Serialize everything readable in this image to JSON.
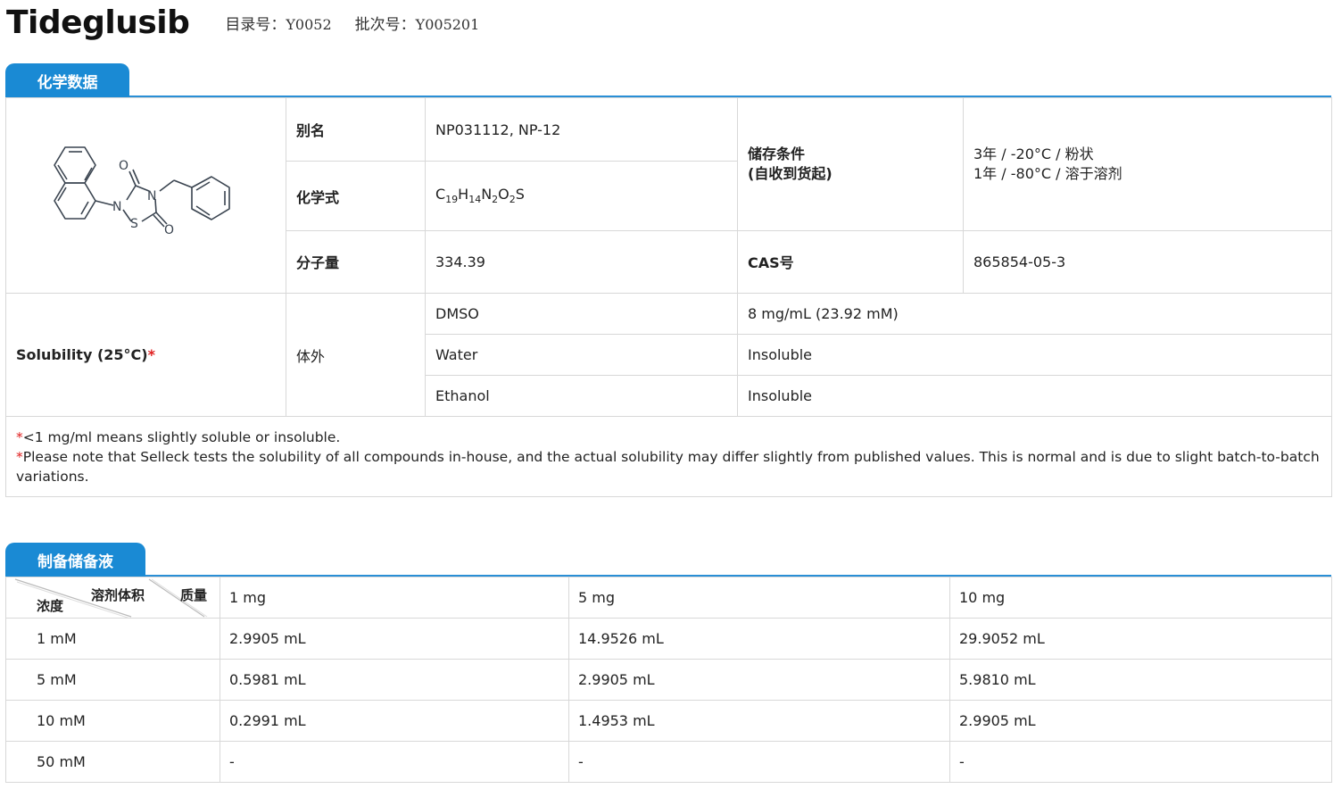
{
  "header": {
    "product_name": "Tideglusib",
    "catalog_label": "目录号：",
    "catalog_value": "Y0052",
    "batch_label": "批次号：",
    "batch_value": "Y005201"
  },
  "chemical_section": {
    "tab_label": "化学数据",
    "structure": {
      "atom_labels": [
        "O",
        "N",
        "N",
        "S",
        "O"
      ]
    },
    "alias_label": "别名",
    "alias_value": "NP031112, NP-12",
    "formula_label": "化学式",
    "formula_parts": [
      "C",
      "19",
      "H",
      "14",
      "N",
      "2",
      "O",
      "2",
      "S"
    ],
    "mw_label": "分子量",
    "mw_value": "334.39",
    "storage_label_line1": "储存条件",
    "storage_label_line2": "(自收到货起)",
    "storage_value_line1": "3年 / -20°C / 粉状",
    "storage_value_line2": "1年 / -80°C / 溶于溶剂",
    "cas_label": "CAS号",
    "cas_value": "865854-05-3",
    "solubility_label": "Solubility (25°C)",
    "solubility_star": "*",
    "in_vitro_label": "体外",
    "solvents": [
      {
        "name": "DMSO",
        "value": "8 mg/mL (23.92 mM)"
      },
      {
        "name": "Water",
        "value": "Insoluble"
      },
      {
        "name": "Ethanol",
        "value": "Insoluble"
      }
    ],
    "notes": [
      {
        "star": "*",
        "text": "<1 mg/ml means slightly soluble or insoluble."
      },
      {
        "star": "*",
        "text": "Please note that Selleck tests the solubility of all compounds in-house, and the actual solubility may differ slightly from published values. This is normal and is due to slight batch-to-batch variations."
      }
    ]
  },
  "stock_section": {
    "tab_label": "制备储备液",
    "corner": {
      "concentration": "浓度",
      "volume": "溶剂体积",
      "mass": "质量"
    },
    "columns": [
      "1 mg",
      "5 mg",
      "10 mg"
    ],
    "rows": [
      {
        "conc": "1 mM",
        "values": [
          "2.9905 mL",
          "14.9526 mL",
          "29.9052 mL"
        ]
      },
      {
        "conc": "5 mM",
        "values": [
          "0.5981 mL",
          "2.9905 mL",
          "5.9810 mL"
        ]
      },
      {
        "conc": "10 mM",
        "values": [
          "0.2991 mL",
          "1.4953 mL",
          "2.9905 mL"
        ]
      },
      {
        "conc": "50 mM",
        "values": [
          "-",
          "-",
          "-"
        ]
      }
    ]
  },
  "colors": {
    "accent": "#1a8ad4",
    "required_star": "#e02020",
    "border": "#d8d8d8"
  }
}
